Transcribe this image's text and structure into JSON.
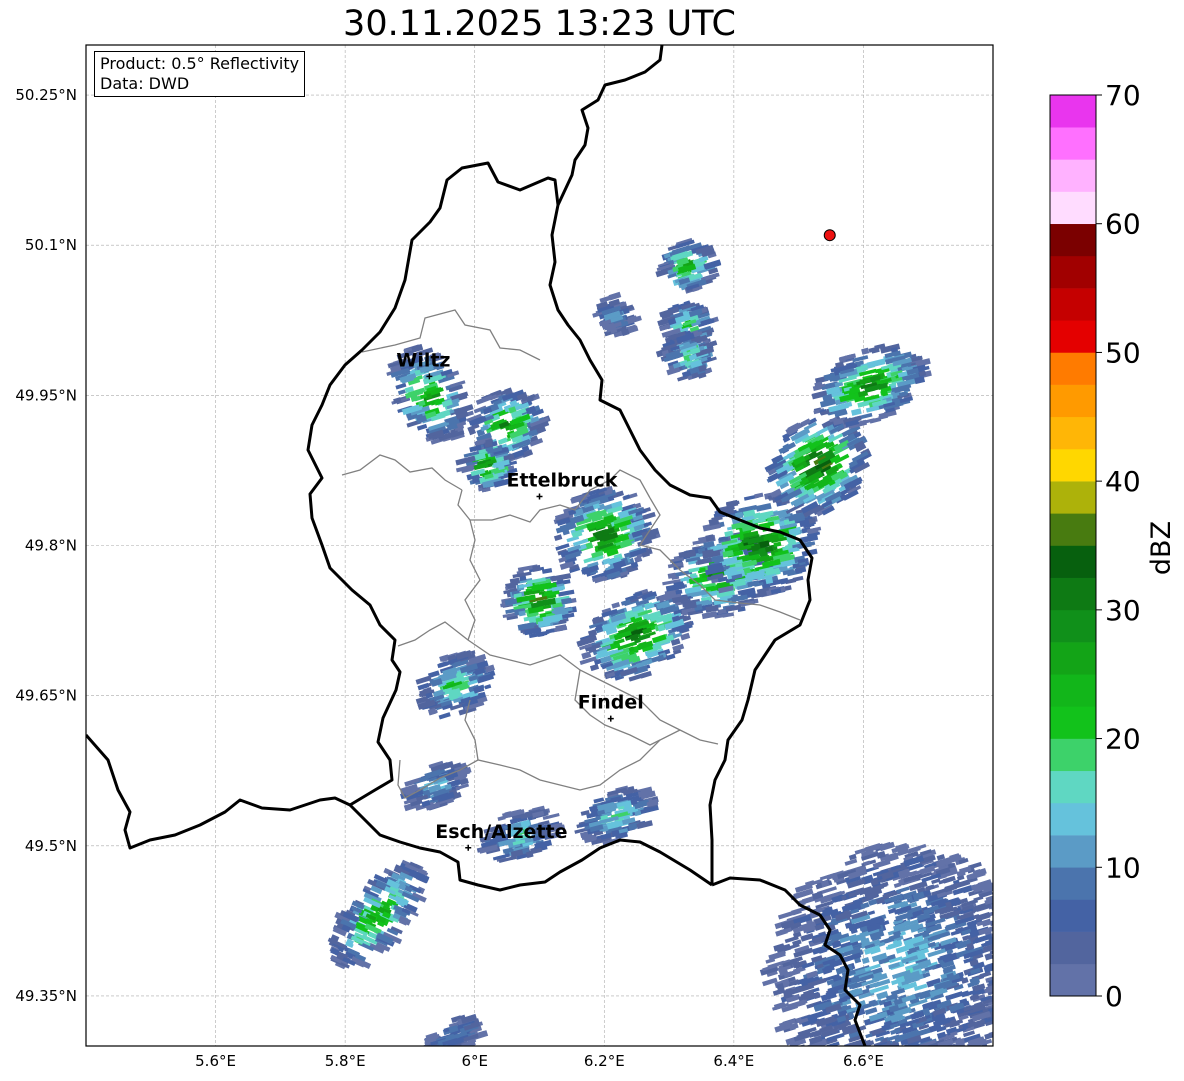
{
  "title": "30.11.2025 13:23 UTC",
  "info": {
    "product": "Product: 0.5° Reflectivity",
    "data": "Data: DWD"
  },
  "map": {
    "lon_range": [
      5.4,
      6.8
    ],
    "lat_range": [
      49.3,
      50.3
    ],
    "lon_ticks": [
      {
        "value": 5.6,
        "label": "5.6°E"
      },
      {
        "value": 5.8,
        "label": "5.8°E"
      },
      {
        "value": 6.0,
        "label": "6°E"
      },
      {
        "value": 6.2,
        "label": "6.2°E"
      },
      {
        "value": 6.4,
        "label": "6.4°E"
      },
      {
        "value": 6.6,
        "label": "6.6°E"
      }
    ],
    "lat_ticks": [
      {
        "value": 50.25,
        "label": "50.25°N"
      },
      {
        "value": 50.1,
        "label": "50.1°N"
      },
      {
        "value": 49.95,
        "label": "49.95°N"
      },
      {
        "value": 49.8,
        "label": "49.8°N"
      },
      {
        "value": 49.65,
        "label": "49.65°N"
      },
      {
        "value": 49.5,
        "label": "49.5°N"
      },
      {
        "value": 49.35,
        "label": "49.35°N"
      }
    ],
    "cities": [
      {
        "name": "Wiltz",
        "lon": 5.93,
        "lat": 49.969
      },
      {
        "name": "Ettelbruck",
        "lon": 6.1,
        "lat": 49.849
      },
      {
        "name": "Findel",
        "lon": 6.21,
        "lat": 49.627
      },
      {
        "name": "Esch/Alzette",
        "lon": 5.99,
        "lat": 49.498
      }
    ],
    "radar_site": {
      "lon": 6.548,
      "lat": 50.11,
      "color": "#ee1111"
    },
    "echo_clusters": [
      {
        "lon": 5.93,
        "lat": 49.95,
        "rx": 0.05,
        "ry": 0.05,
        "peak": 28,
        "angle": -0.5
      },
      {
        "lon": 6.05,
        "lat": 49.92,
        "rx": 0.055,
        "ry": 0.035,
        "peak": 30,
        "angle": -0.6
      },
      {
        "lon": 6.02,
        "lat": 49.88,
        "rx": 0.035,
        "ry": 0.025,
        "peak": 32,
        "angle": -0.4
      },
      {
        "lon": 6.2,
        "lat": 49.81,
        "rx": 0.075,
        "ry": 0.045,
        "peak": 33,
        "angle": -0.5
      },
      {
        "lon": 6.1,
        "lat": 49.745,
        "rx": 0.05,
        "ry": 0.035,
        "peak": 36,
        "angle": -0.3
      },
      {
        "lon": 6.25,
        "lat": 49.71,
        "rx": 0.085,
        "ry": 0.04,
        "peak": 34,
        "angle": -0.5
      },
      {
        "lon": 6.38,
        "lat": 49.77,
        "rx": 0.08,
        "ry": 0.04,
        "peak": 31,
        "angle": -0.3
      },
      {
        "lon": 6.44,
        "lat": 49.8,
        "rx": 0.09,
        "ry": 0.05,
        "peak": 35,
        "angle": -0.35
      },
      {
        "lon": 6.53,
        "lat": 49.88,
        "rx": 0.08,
        "ry": 0.045,
        "peak": 38,
        "angle": -0.8
      },
      {
        "lon": 6.61,
        "lat": 49.96,
        "rx": 0.09,
        "ry": 0.035,
        "peak": 31,
        "angle": -0.4
      },
      {
        "lon": 6.33,
        "lat": 50.08,
        "rx": 0.04,
        "ry": 0.025,
        "peak": 30,
        "angle": -0.5
      },
      {
        "lon": 6.33,
        "lat": 50.02,
        "rx": 0.035,
        "ry": 0.025,
        "peak": 24,
        "angle": -0.5
      },
      {
        "lon": 6.33,
        "lat": 49.99,
        "rx": 0.035,
        "ry": 0.025,
        "peak": 22,
        "angle": -0.5
      },
      {
        "lon": 6.22,
        "lat": 50.03,
        "rx": 0.025,
        "ry": 0.02,
        "peak": 12,
        "angle": -0.5
      },
      {
        "lon": 5.97,
        "lat": 49.66,
        "rx": 0.06,
        "ry": 0.03,
        "peak": 22,
        "angle": -0.5
      },
      {
        "lon": 5.94,
        "lat": 49.56,
        "rx": 0.05,
        "ry": 0.02,
        "peak": 16,
        "angle": -0.5
      },
      {
        "lon": 6.07,
        "lat": 49.51,
        "rx": 0.06,
        "ry": 0.025,
        "peak": 18,
        "angle": -0.4
      },
      {
        "lon": 6.22,
        "lat": 49.53,
        "rx": 0.06,
        "ry": 0.025,
        "peak": 20,
        "angle": -0.4
      },
      {
        "lon": 5.85,
        "lat": 49.43,
        "rx": 0.04,
        "ry": 0.065,
        "peak": 28,
        "angle": 0.7
      },
      {
        "lon": 6.65,
        "lat": 49.38,
        "rx": 0.2,
        "ry": 0.12,
        "peak": 14,
        "angle": -0.5
      },
      {
        "lon": 5.97,
        "lat": 49.31,
        "rx": 0.05,
        "ry": 0.015,
        "peak": 12,
        "angle": -0.5
      }
    ]
  },
  "colorbar": {
    "label": "dBZ",
    "min": 0,
    "max": 70,
    "ticks": [
      0,
      10,
      20,
      30,
      40,
      50,
      60,
      70
    ],
    "colors": [
      "#6272a8",
      "#52659e",
      "#4462a5",
      "#4b74ad",
      "#5b9bc6",
      "#65c2dc",
      "#5fd7c2",
      "#3dd26a",
      "#12c21b",
      "#12b61a",
      "#13a417",
      "#10901a",
      "#0e7a14",
      "#07600e",
      "#487b10",
      "#adb20a",
      "#ffd700",
      "#ffb606",
      "#ff9a00",
      "#ff7b00",
      "#e40000",
      "#c50000",
      "#a10000",
      "#7b0000",
      "#ffdcff",
      "#ffb2ff",
      "#ff70ff",
      "#e935ee"
    ]
  }
}
